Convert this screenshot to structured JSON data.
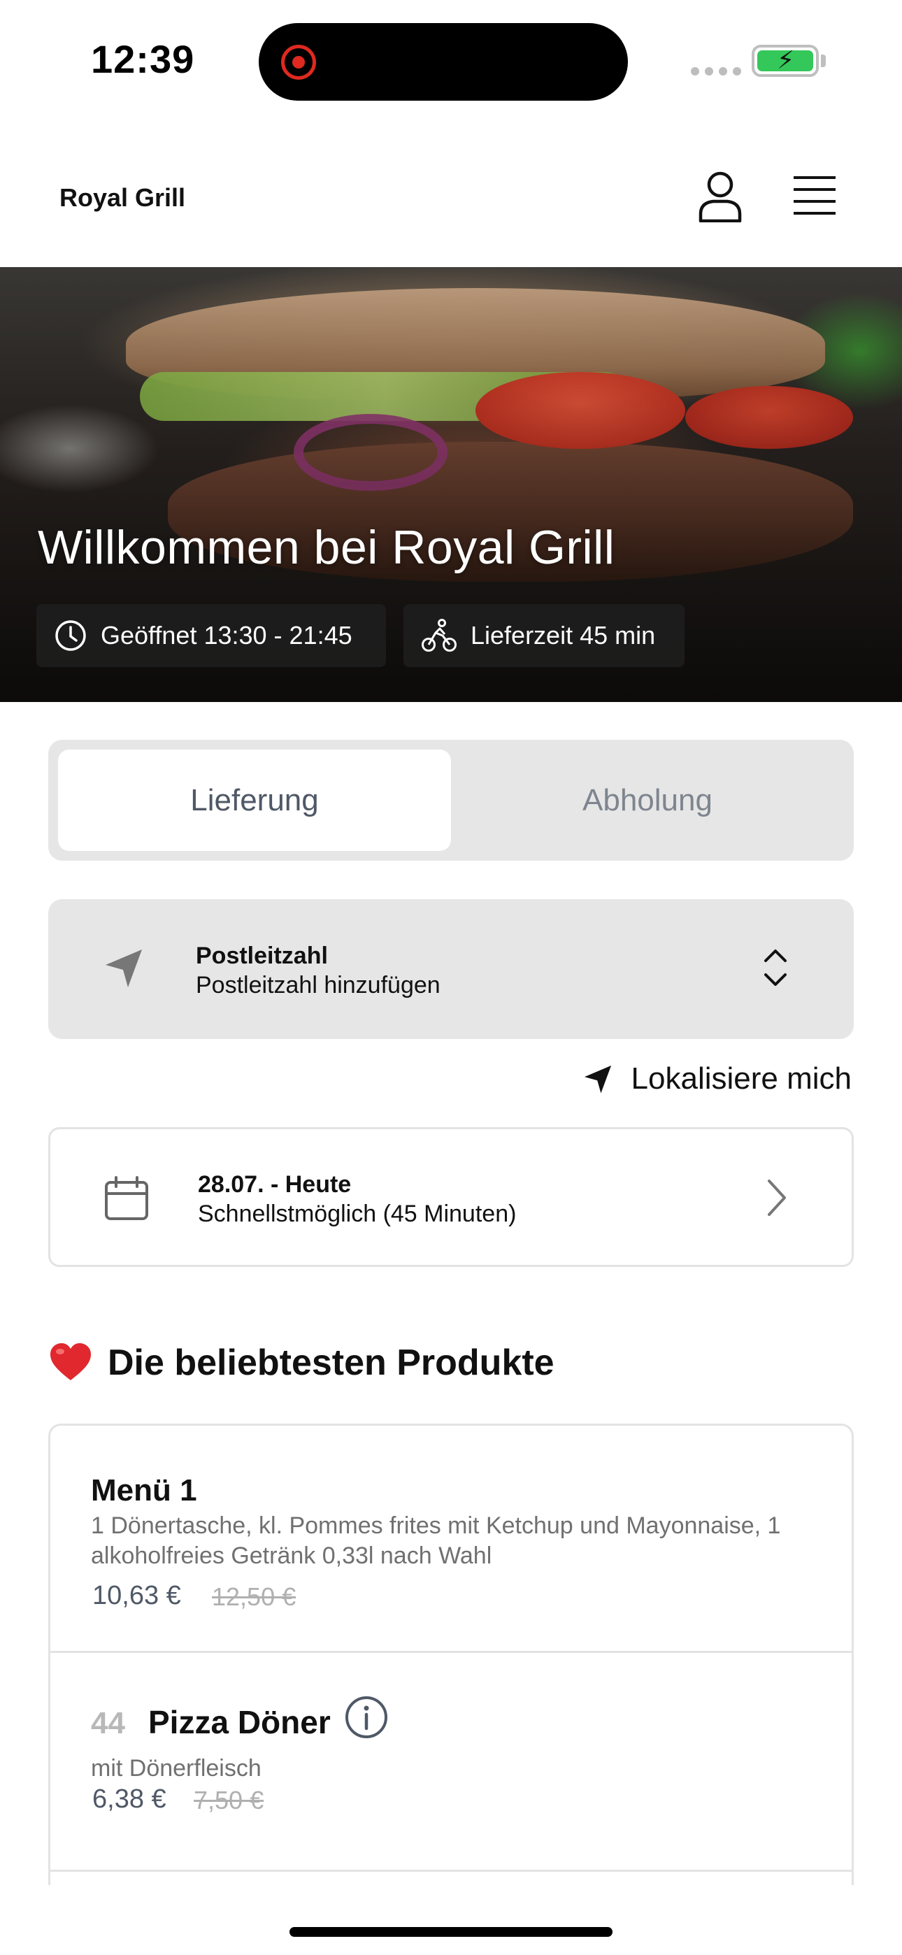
{
  "status_bar": {
    "time": "12:39"
  },
  "header": {
    "brand": "Royal Grill"
  },
  "hero": {
    "title": "Willkommen bei Royal Grill",
    "opening_hours": "Geöffnet 13:30 - 21:45",
    "delivery_time": "Lieferzeit 45 min"
  },
  "mode_toggle": {
    "options": [
      "Lieferung",
      "Abholung"
    ],
    "selected": "Lieferung"
  },
  "postcode": {
    "title": "Postleitzahl",
    "placeholder": "Postleitzahl hinzufügen"
  },
  "locate": {
    "label": "Lokalisiere mich"
  },
  "date_picker": {
    "title": "28.07. - Heute",
    "subtitle": "Schnellstmöglich (45 Minuten)"
  },
  "popular": {
    "heading": "Die beliebtesten Produkte",
    "products": [
      {
        "name": "Menü 1",
        "description": "1 Dönertasche, kl. Pommes frites mit Ketchup und Mayonnaise, 1 alkoholfreies Getränk 0,33l nach Wahl",
        "price": "10,63 €",
        "old_price": "12,50 €"
      },
      {
        "number": "44",
        "name": "Pizza Döner",
        "description": "mit Dönerfleisch",
        "price": "6,38 €",
        "old_price": "7,50 €"
      }
    ]
  },
  "colors": {
    "accent_text": "#4f5866",
    "panel_bg": "#e6e6e6",
    "battery_green": "#34c759",
    "record_red": "#e0291f"
  },
  "icons": [
    "user-icon",
    "menu-icon",
    "clock-icon",
    "bicycle-icon",
    "location-arrow-icon",
    "chevron-up-down-icon",
    "calendar-icon",
    "chevron-right-icon",
    "heart-icon",
    "info-icon"
  ]
}
